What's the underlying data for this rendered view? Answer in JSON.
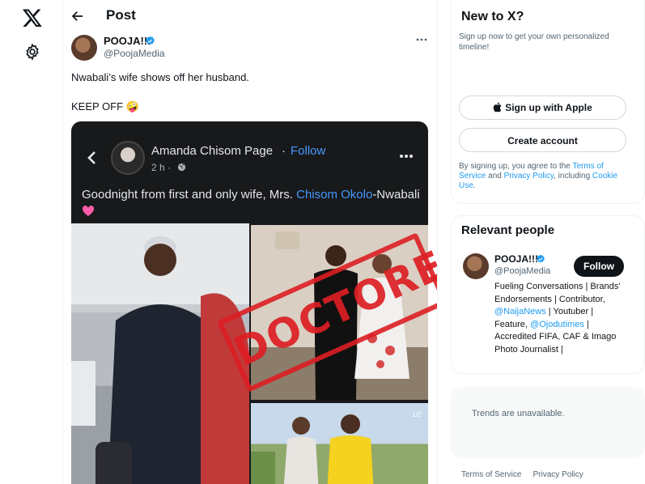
{
  "nav": {
    "logo": "x-logo-icon",
    "settings": "gear-icon"
  },
  "header": {
    "title": "Post"
  },
  "post": {
    "author_name": "POOJA!!!",
    "author_handle": "@PoojaMedia",
    "text_line1": "Nwabali’s wife shows off her husband.",
    "text_line2": "KEEP OFF 🤪"
  },
  "embedded": {
    "page_name": "Amanda Chisom Page",
    "separator": "·",
    "follow": "Follow",
    "time": "2 h ·",
    "caption_prefix": "Goodnight from first and only wife, Mrs. ",
    "caption_name": "Chisom Okolo",
    "caption_suffix": "-Nwabali",
    "photo_count": "1/2",
    "stamp_text": "DOCTORED"
  },
  "sidebar": {
    "new_title": "New to X?",
    "new_subtitle": "Sign up now to get your own personalized timeline!",
    "apple_button": "Sign up with Apple",
    "create_button": "Create account",
    "legal_prefix": "By signing up, you agree to the ",
    "legal_terms": "Terms of Service",
    "legal_and": " and ",
    "legal_privacy": "Privacy Policy",
    "legal_including": ", including ",
    "legal_cookie": "Cookie Use",
    "legal_end": ".",
    "people_title": "Relevant people",
    "person_name": "POOJA!!!",
    "person_handle": "@PoojaMedia",
    "person_follow": "Follow",
    "bio_1": "Fueling Conversations | Brands' Endorsements | Contributor, ",
    "bio_link1": "@NaijaNews",
    "bio_2": " | Youtuber | Feature, ",
    "bio_link2": "@Ojodutimes",
    "bio_3": " | Accredited FIFA, CAF & Imago Photo Journalist |",
    "trends": "Trends are unavailable.",
    "footer_terms": "Terms of Service",
    "footer_privacy": "Privacy Policy"
  },
  "colors": {
    "accent": "#1d9bf0",
    "stamp": "#dc1e24",
    "fb_link": "#4599ff"
  }
}
